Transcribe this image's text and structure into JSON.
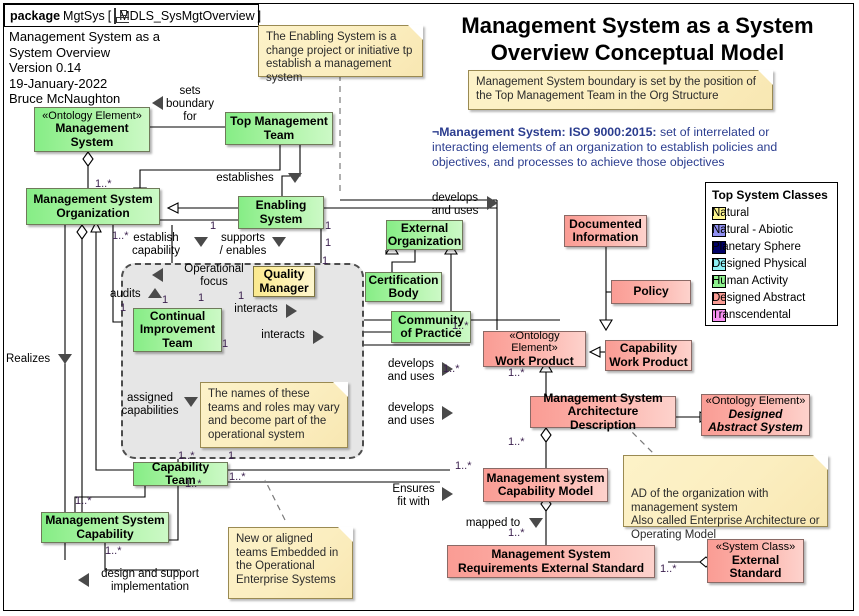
{
  "package": {
    "keyword": "package",
    "name": "MgtSys",
    "bracket_open": "[",
    "icon": "package-diagram-icon",
    "diagram_name": "MDLS_SysMgtOverview",
    "bracket_close": "]"
  },
  "meta": {
    "text": "Management System as a\nSystem Overview\nVersion 0.14\n19-January-2022\nBruce McNaughton"
  },
  "title": {
    "line1": "Management System as a System",
    "line2": "Overview Conceptual Model"
  },
  "notes": [
    {
      "id": "note-enabling-system",
      "text": "The Enabling System is a change project or initiative tp establish a management system"
    },
    {
      "id": "note-boundary",
      "text": "Management System boundary is set by the position of the Top Management Team in the Org Structure"
    },
    {
      "id": "note-team-names",
      "text": "The names of these teams and roles may vary and become part of the operational system"
    },
    {
      "id": "note-new-teams",
      "text": "New or aligned teams Embedded in the Operational Enterprise Systems"
    },
    {
      "id": "note-ad",
      "text": "AD of the organization with management system\nAlso called Enterprise Architecture or Operating Model"
    }
  ],
  "iso_definition": {
    "marker": "¬",
    "heading": "Management System:  ISO 9000:2015:",
    "body": "  set of interrelated or interacting elements of an organization to establish policies and objectives, and processes to achieve those objectives"
  },
  "legend": {
    "title": "Top System Classes",
    "items": [
      {
        "label": "Natural",
        "color": "#fdf68f"
      },
      {
        "label": "Natural - Abiotic",
        "color": "#8f8ff0"
      },
      {
        "label": "Planetary Sphere",
        "color": "#000066"
      },
      {
        "label": "Designed Physical",
        "color": "#8ff2f7"
      },
      {
        "label": "Human Activity",
        "color": "#8ef28e"
      },
      {
        "label": "Designed Abstract",
        "color": "#fa9c94"
      },
      {
        "label": "Transcendental",
        "color": "#f78ff2"
      }
    ]
  },
  "classes": [
    {
      "id": "management-system",
      "stereotype": "«Ontology Element»",
      "name": "Management System",
      "kind": "green"
    },
    {
      "id": "top-management-team",
      "stereotype": "",
      "name": "Top Management Team",
      "kind": "green"
    },
    {
      "id": "management-system-organization",
      "stereotype": "",
      "name": "Management System Organization",
      "kind": "green"
    },
    {
      "id": "enabling-system",
      "stereotype": "",
      "name": "Enabling System",
      "kind": "green"
    },
    {
      "id": "external-organization",
      "stereotype": "",
      "name": "External Organization",
      "kind": "green"
    },
    {
      "id": "certification-body",
      "stereotype": "",
      "name": "Certification Body",
      "kind": "green"
    },
    {
      "id": "community-of-practice",
      "stereotype": "",
      "name": "Community of Practice",
      "kind": "green"
    },
    {
      "id": "quality-manager",
      "stereotype": "",
      "name": "Quality Manager",
      "kind": "yellow"
    },
    {
      "id": "continual-improvement-team",
      "stereotype": "",
      "name": "Continual Improvement Team",
      "kind": "green"
    },
    {
      "id": "capability-team",
      "stereotype": "",
      "name": "Capability Team",
      "kind": "green"
    },
    {
      "id": "management-system-capability",
      "stereotype": "",
      "name": "Management System Capability",
      "kind": "green"
    },
    {
      "id": "documented-information",
      "stereotype": "",
      "name": "Documented Information",
      "kind": "red"
    },
    {
      "id": "policy",
      "stereotype": "",
      "name": "Policy",
      "kind": "red"
    },
    {
      "id": "work-product",
      "stereotype": "«Ontology Element»",
      "name": "Work Product",
      "kind": "red"
    },
    {
      "id": "capability-work-product",
      "stereotype": "",
      "name": "Capability Work Product",
      "kind": "red"
    },
    {
      "id": "management-system-architecture-description",
      "stereotype": "",
      "name": "Management System Architecture Description",
      "kind": "red"
    },
    {
      "id": "designed-abstract-system",
      "stereotype": "«Ontology Element»",
      "name": "Designed Abstract System",
      "kind": "red"
    },
    {
      "id": "management-system-capability-model",
      "stereotype": "",
      "name": "Management system Capability Model",
      "kind": "red"
    },
    {
      "id": "management-system-requirements-external-standard",
      "stereotype": "",
      "name": "Management System Requirements External Standard",
      "kind": "red"
    },
    {
      "id": "external-standard",
      "stereotype": "«System Class»",
      "name": "External Standard",
      "kind": "red"
    }
  ],
  "relationship_labels": [
    {
      "id": "sets-boundary-for",
      "text": "sets\nboundary\nfor"
    },
    {
      "id": "establishes",
      "text": "establishes"
    },
    {
      "id": "establish-capability",
      "text": "establish\ncapability"
    },
    {
      "id": "supports-enables",
      "text": "supports\n/ enables"
    },
    {
      "id": "operational-focus",
      "text": "Operational\nfocus"
    },
    {
      "id": "audits",
      "text": "audits"
    },
    {
      "id": "interacts-1",
      "text": "interacts"
    },
    {
      "id": "interacts-2",
      "text": "interacts"
    },
    {
      "id": "assigned-capabilities",
      "text": "assigned\ncapabilities"
    },
    {
      "id": "realizes",
      "text": "Realizes"
    },
    {
      "id": "develops-and-uses-1",
      "text": "develops\nand uses"
    },
    {
      "id": "develops-and-uses-2",
      "text": "develops\nand uses"
    },
    {
      "id": "develops-and-uses-3",
      "text": "develops\nand uses"
    },
    {
      "id": "ensures-fit-with",
      "text": "Ensures\nfit with"
    },
    {
      "id": "mapped-to",
      "text": "mapped to"
    },
    {
      "id": "design-and-support-implementation",
      "text": "design and support\nimplementation"
    }
  ],
  "multiplicities": [
    {
      "id": "m1",
      "text": "1..*"
    },
    {
      "id": "m2",
      "text": "1..*"
    },
    {
      "id": "m3",
      "text": "1"
    },
    {
      "id": "m4",
      "text": "1"
    },
    {
      "id": "m5",
      "text": "1"
    },
    {
      "id": "m6",
      "text": "1"
    },
    {
      "id": "m7",
      "text": "1"
    },
    {
      "id": "m8",
      "text": "1"
    },
    {
      "id": "m9",
      "text": "1"
    },
    {
      "id": "m10",
      "text": "1"
    },
    {
      "id": "m11",
      "text": "1..*"
    },
    {
      "id": "m12",
      "text": "1"
    },
    {
      "id": "m13",
      "text": "1"
    },
    {
      "id": "m14",
      "text": "1..*"
    },
    {
      "id": "m15",
      "text": "1..*"
    },
    {
      "id": "m16",
      "text": "1..*"
    },
    {
      "id": "m17",
      "text": "1..*"
    },
    {
      "id": "m18",
      "text": "1..*"
    },
    {
      "id": "m19",
      "text": "1..*"
    },
    {
      "id": "m20",
      "text": "1..*"
    },
    {
      "id": "m21",
      "text": "1..*"
    },
    {
      "id": "m22",
      "text": "1..*"
    },
    {
      "id": "m23",
      "text": "1..*"
    },
    {
      "id": "m24",
      "text": "1..*"
    }
  ]
}
